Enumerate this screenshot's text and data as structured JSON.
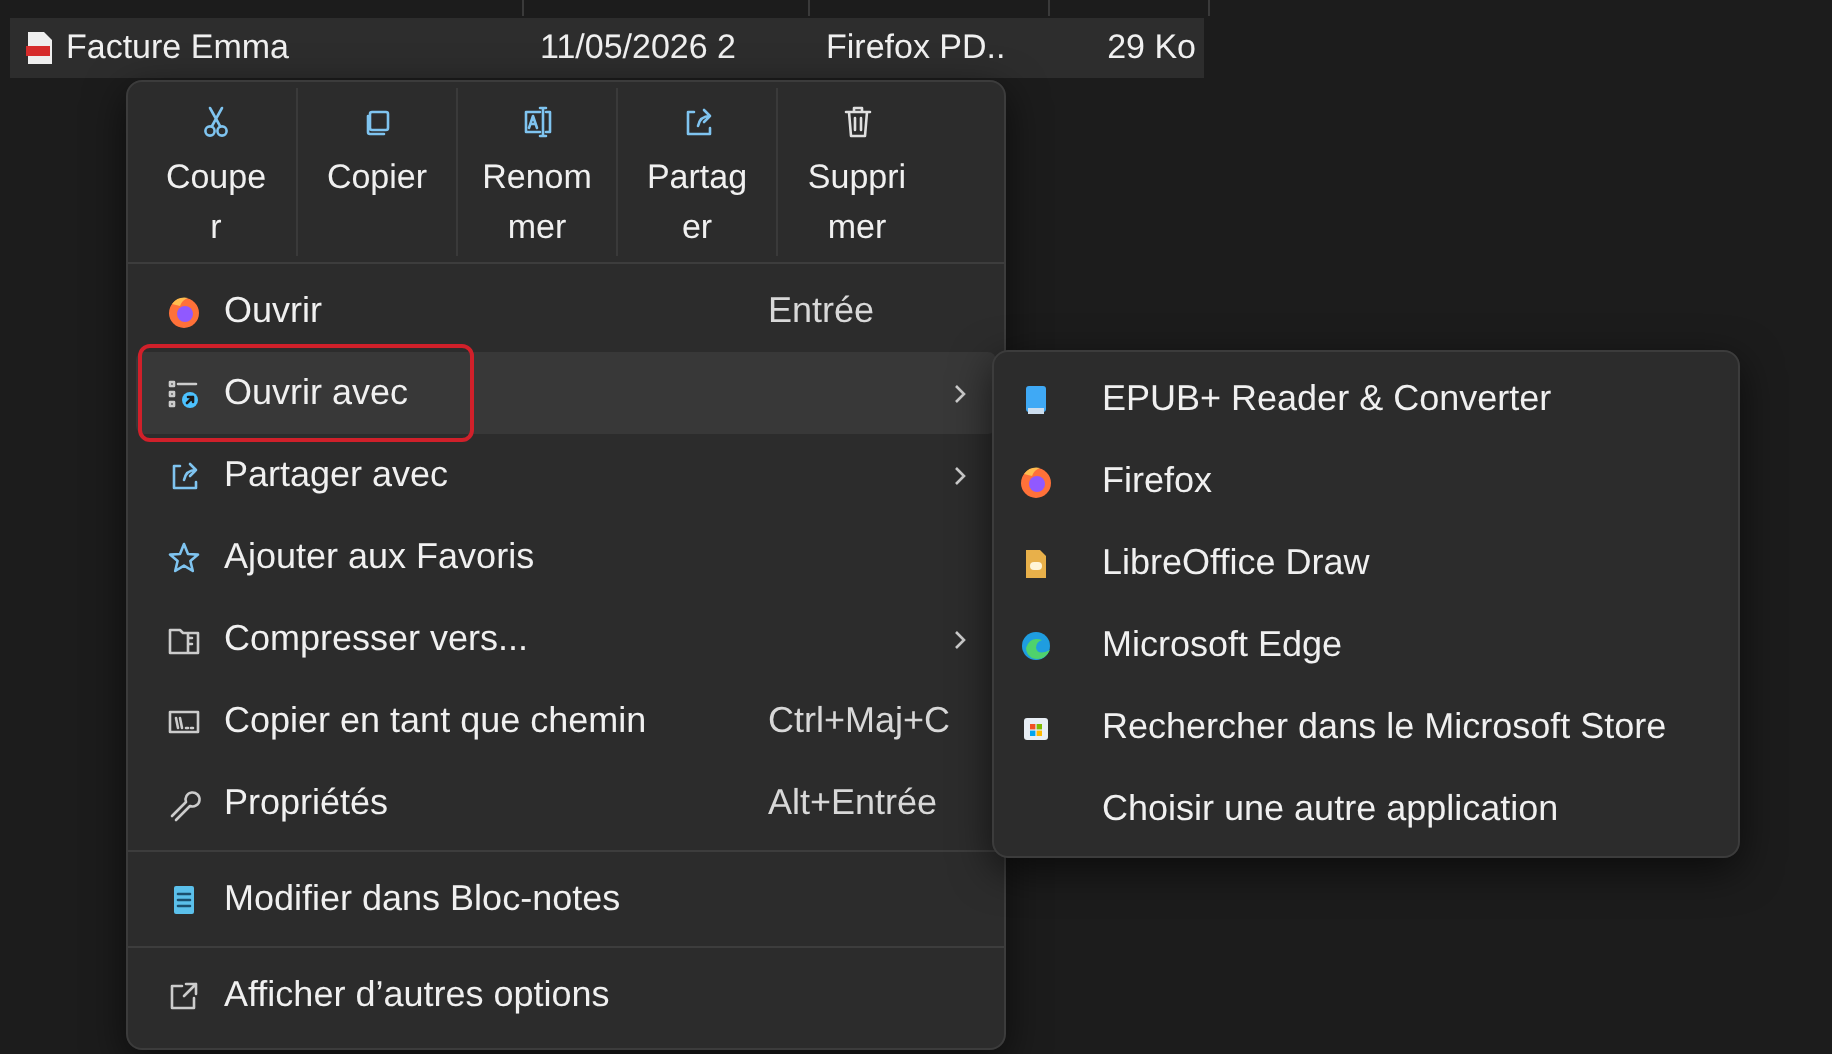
{
  "file_row": {
    "name": "Facture Emma",
    "date": "11/05/2026 2",
    "type": "Firefox PD..",
    "size": "29 Ko",
    "selected": true
  },
  "context_menu": {
    "toolbar": [
      {
        "label_lines": [
          "Coupe",
          "r"
        ]
      },
      {
        "label_lines": [
          "Copier"
        ]
      },
      {
        "label_lines": [
          "Renom",
          "mer"
        ]
      },
      {
        "label_lines": [
          "Partag",
          "er"
        ]
      },
      {
        "label_lines": [
          "Suppri",
          "mer"
        ]
      }
    ],
    "groups": [
      [
        {
          "label": "Ouvrir",
          "shortcut": "Entrée",
          "submenu": false,
          "selected": false,
          "outlined": false
        },
        {
          "label": "Ouvrir avec",
          "submenu": true,
          "selected": true,
          "outlined": true
        },
        {
          "label": "Partager avec",
          "submenu": true,
          "selected": false,
          "outlined": false
        },
        {
          "label": "Ajouter aux Favoris",
          "submenu": false,
          "selected": false,
          "outlined": false
        },
        {
          "label": "Compresser vers...",
          "submenu": true,
          "selected": false,
          "outlined": false
        },
        {
          "label": "Copier en tant que chemin",
          "shortcut": "Ctrl+Maj+C",
          "submenu": false,
          "selected": false,
          "outlined": false
        },
        {
          "label": "Propriétés",
          "shortcut": "Alt+Entrée",
          "submenu": false,
          "selected": false,
          "outlined": false
        }
      ],
      [
        {
          "label": "Modifier dans Bloc-notes",
          "submenu": false,
          "selected": false,
          "outlined": false
        }
      ],
      [
        {
          "label": "Afficher d’autres options",
          "submenu": false,
          "selected": false,
          "outlined": false
        }
      ]
    ]
  },
  "submenu": {
    "items": [
      {
        "label": "EPUB+ Reader & Converter"
      },
      {
        "label": "Firefox"
      },
      {
        "label": "LibreOffice Draw"
      },
      {
        "label": "Microsoft Edge"
      },
      {
        "label": "Rechercher dans le Microsoft Store"
      },
      {
        "label": "Choisir une autre application"
      }
    ]
  }
}
